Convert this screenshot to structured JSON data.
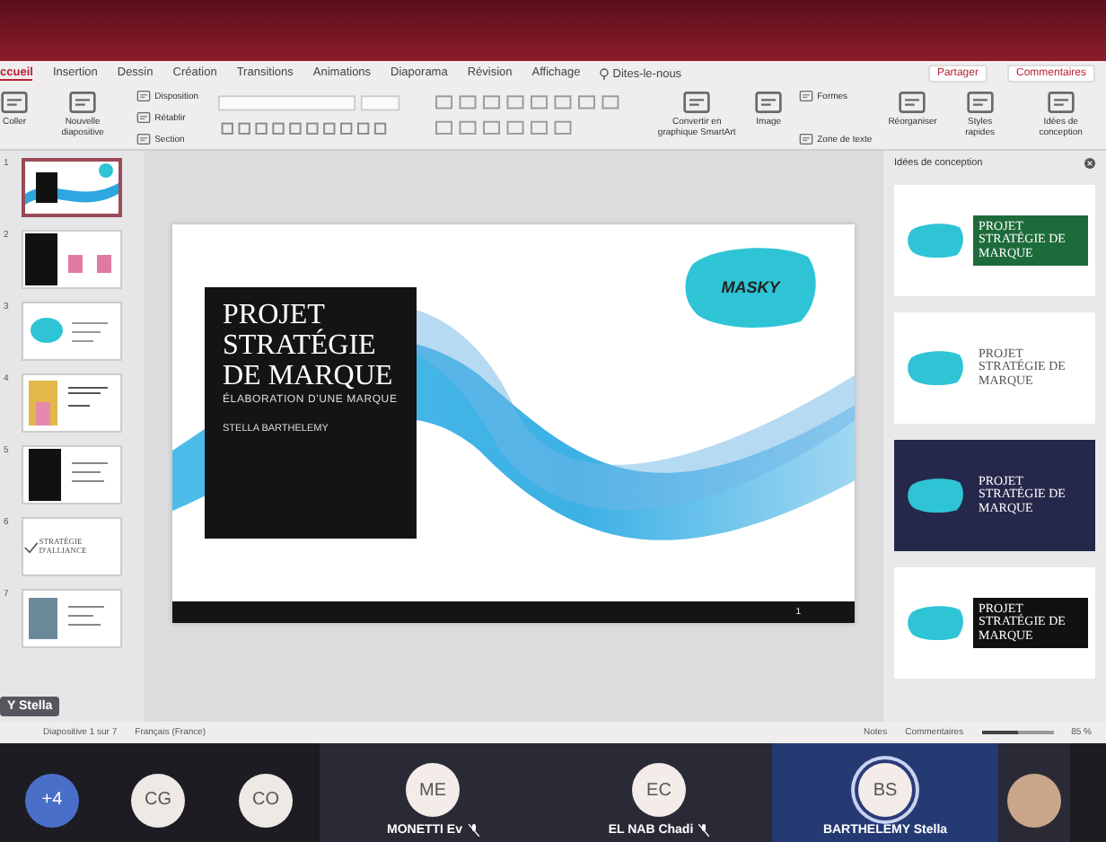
{
  "ribbon": {
    "tabs": [
      {
        "label": "ccueil",
        "selected": true
      },
      {
        "label": "Insertion",
        "selected": false
      },
      {
        "label": "Dessin",
        "selected": false
      },
      {
        "label": "Création",
        "selected": false
      },
      {
        "label": "Transitions",
        "selected": false
      },
      {
        "label": "Animations",
        "selected": false
      },
      {
        "label": "Diaporama",
        "selected": false
      },
      {
        "label": "Révision",
        "selected": false
      },
      {
        "label": "Affichage",
        "selected": false
      }
    ],
    "tell_me": "Dites-le-nous",
    "share": "Partager",
    "comments": "Commentaires"
  },
  "toolbar": [
    {
      "kind": "large",
      "label": "Coller"
    },
    {
      "kind": "large",
      "label": "Nouvelle diapositive"
    },
    {
      "kind": "stack",
      "items": [
        "Disposition",
        "Rétablir",
        "Section"
      ]
    },
    {
      "kind": "format"
    },
    {
      "kind": "large",
      "label": "Convertir en graphique SmartArt"
    },
    {
      "kind": "large",
      "label": "Image"
    },
    {
      "kind": "stack",
      "items": [
        "Formes",
        "Zone de texte"
      ]
    },
    {
      "kind": "large",
      "label": "Réorganiser"
    },
    {
      "kind": "large",
      "label": "Styles rapides"
    },
    {
      "kind": "large",
      "label": "Idées de conception"
    }
  ],
  "thumbnails": [
    {
      "number": "1",
      "kind": "wave",
      "selected": true
    },
    {
      "number": "2",
      "kind": "split",
      "selected": false
    },
    {
      "number": "3",
      "kind": "logo",
      "selected": false
    },
    {
      "number": "4",
      "kind": "photo",
      "selected": false
    },
    {
      "number": "5",
      "kind": "dark",
      "selected": false
    },
    {
      "number": "6",
      "kind": "check",
      "text": "STRATÉGIE D'ALLIANCE",
      "selected": false
    },
    {
      "number": "7",
      "kind": "collage",
      "selected": false
    }
  ],
  "slide": {
    "title": "PROJET STRATÉGIE DE MARQUE",
    "subtitle": "ÉLABORATION D'UNE MARQUE",
    "author": "STELLA BARTHELEMY",
    "logo": "MASKY",
    "page": "1"
  },
  "design_ideas": {
    "title": "Idées de conception",
    "ideas": [
      {
        "kind": "green",
        "title": "PROJET STRATÉGIE DE MARQUE"
      },
      {
        "kind": "white",
        "title": "PROJET STRATÉGIE DE MARQUE"
      },
      {
        "kind": "navy",
        "title": "PROJET STRATÉGIE DE MARQUE"
      },
      {
        "kind": "black",
        "title": "PROJET STRATÉGIE DE MARQUE"
      }
    ]
  },
  "status_bar": {
    "slide": "Diapositive 1 sur 7",
    "language": "Français (France)",
    "notes": "Notes",
    "comments": "Commentaires",
    "zoom": "85 %",
    "zoom_slider": {
      "level": 0.5
    }
  },
  "call": {
    "name_tag": "Y Stella",
    "participants": [
      {
        "kind": "more",
        "initials": "+4"
      },
      {
        "kind": "avatar",
        "initials": "CG"
      },
      {
        "kind": "avatar",
        "initials": "CO"
      },
      {
        "kind": "tile",
        "initials": "ME",
        "name": "MONETTI Ev",
        "muted": true,
        "speaking": false
      },
      {
        "kind": "tile",
        "initials": "EC",
        "name": "EL NAB Chadi",
        "muted": true,
        "speaking": false
      },
      {
        "kind": "tile",
        "initials": "BS",
        "name": "BARTHELEMY Stella",
        "muted": false,
        "speaking": true
      },
      {
        "kind": "photo"
      }
    ]
  }
}
